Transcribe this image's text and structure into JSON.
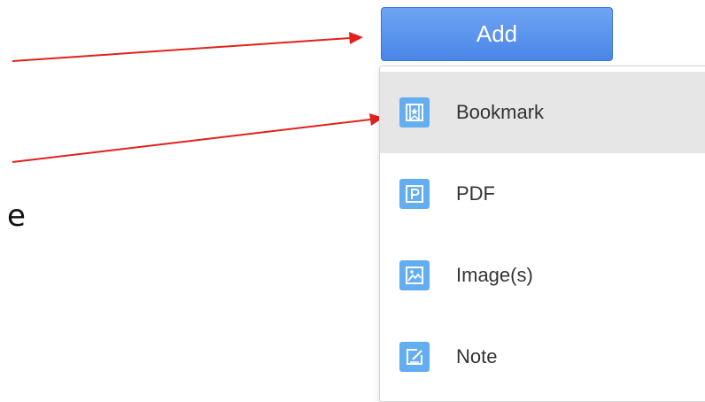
{
  "stray_text": "e",
  "add_button": {
    "label": "Add"
  },
  "menu": {
    "items": [
      {
        "label": "Bookmark",
        "icon": "bookmark-star-icon",
        "active": true
      },
      {
        "label": "PDF",
        "icon": "pdf-icon",
        "active": false
      },
      {
        "label": "Image(s)",
        "icon": "image-icon",
        "active": false
      },
      {
        "label": "Note",
        "icon": "note-edit-icon",
        "active": false
      }
    ]
  },
  "colors": {
    "button_top": "#6fa4f2",
    "button_bottom": "#4a86e8",
    "icon_bg": "#62aef0",
    "active_row": "#e6e6e6",
    "arrow": "#e0221c"
  }
}
